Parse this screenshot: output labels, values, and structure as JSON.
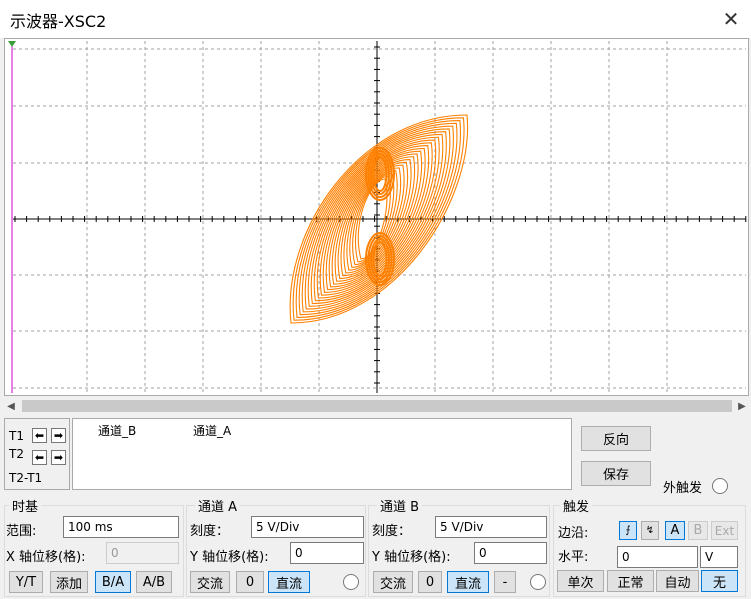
{
  "window": {
    "title": "示波器-XSC2",
    "close_label": "✕"
  },
  "colors": {
    "trace": "#ff8000",
    "grid": "#a0a0a0",
    "axis": "#000000",
    "left_marker": "#cc00cc"
  },
  "plot": {
    "mode": "B/A",
    "trace_description": "Orange X-Y (B/A) Lissajous-type loop trace"
  },
  "readout": {
    "col_b": "通道_B",
    "col_a": "通道_A"
  },
  "cursors": {
    "t1": "T1",
    "t2": "T2",
    "t2t1": "T2-T1"
  },
  "side": {
    "reverse": "反向",
    "save": "保存",
    "ext_trigger": "外触发"
  },
  "timebase": {
    "title": "时基",
    "range_label": "范围:",
    "range_value": "100 ms",
    "xpos_label": "X 轴位移(格):",
    "xpos_value": "0",
    "btn_yt": "Y/T",
    "btn_add": "添加",
    "btn_ba": "B/A",
    "btn_ab": "A/B"
  },
  "channel_a": {
    "title": "通道 A",
    "scale_label": "刻度：",
    "scale_value": "5  V/Div",
    "ypos_label": "Y 轴位移(格):",
    "ypos_value": "0",
    "btn_ac": "交流",
    "btn_zero": "0",
    "btn_dc": "直流"
  },
  "channel_b": {
    "title": "通道 B",
    "scale_label": "刻度：",
    "scale_value": "5  V/Div",
    "ypos_label": "Y 轴位移(格):",
    "ypos_value": "0",
    "btn_ac": "交流",
    "btn_zero": "0",
    "btn_dc": "直流",
    "btn_minus": "-"
  },
  "trigger": {
    "title": "触发",
    "edge_label": "边沿:",
    "level_label": "水平:",
    "level_value": "0",
    "level_unit": "V",
    "src_a": "A",
    "src_b": "B",
    "src_ext": "Ext",
    "btn_single": "单次",
    "btn_normal": "正常",
    "btn_auto": "自动",
    "btn_none": "无"
  }
}
